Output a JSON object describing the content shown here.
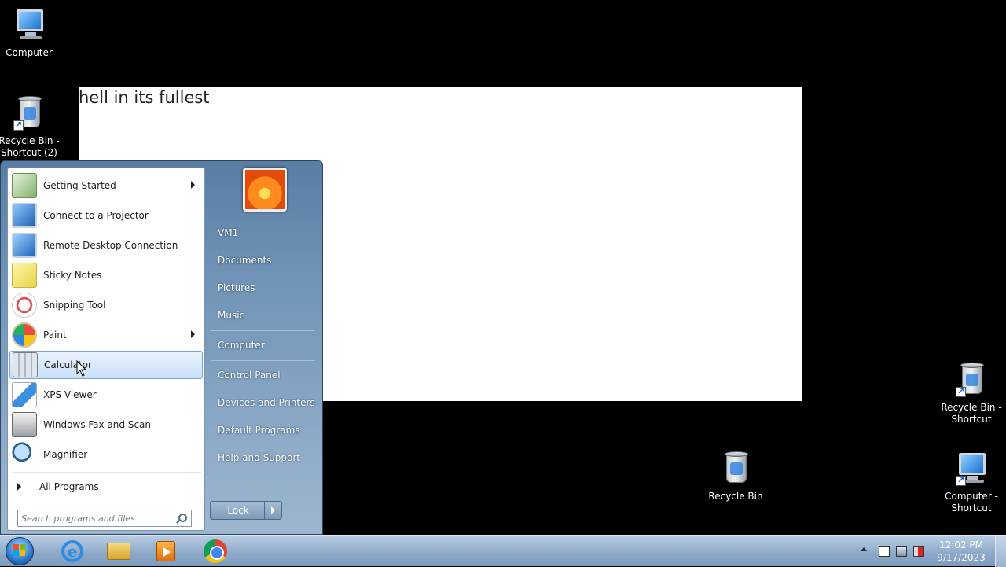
{
  "desktop_icons": {
    "computer": "Computer",
    "recycle_shortcut_2": "Recycle Bin - Shortcut (2)",
    "recycle_bin": "Recycle Bin",
    "recycle_shortcut": "Recycle Bin - Shortcut",
    "computer_shortcut": "Computer - Shortcut"
  },
  "note_window": {
    "text": "hell in its fullest"
  },
  "start_menu": {
    "programs": [
      {
        "label": "Getting Started",
        "icon": "getting-started-icon",
        "submenu": true
      },
      {
        "label": "Connect to a Projector",
        "icon": "projector-icon",
        "submenu": false
      },
      {
        "label": "Remote Desktop Connection",
        "icon": "remote-desktop-icon",
        "submenu": false
      },
      {
        "label": "Sticky Notes",
        "icon": "sticky-notes-icon",
        "submenu": false
      },
      {
        "label": "Snipping Tool",
        "icon": "snipping-tool-icon",
        "submenu": false
      },
      {
        "label": "Paint",
        "icon": "paint-icon",
        "submenu": true
      },
      {
        "label": "Calculator",
        "icon": "calculator-icon",
        "submenu": false,
        "highlighted": true
      },
      {
        "label": "XPS Viewer",
        "icon": "xps-viewer-icon",
        "submenu": false
      },
      {
        "label": "Windows Fax and Scan",
        "icon": "fax-scan-icon",
        "submenu": false
      },
      {
        "label": "Magnifier",
        "icon": "magnifier-icon",
        "submenu": false
      }
    ],
    "all_programs": "All Programs",
    "search_placeholder": "Search programs and files",
    "right_items": {
      "user": "VM1",
      "documents": "Documents",
      "pictures": "Pictures",
      "music": "Music",
      "computer": "Computer",
      "control_panel": "Control Panel",
      "devices": "Devices and Printers",
      "default_programs": "Default Programs",
      "help": "Help and Support"
    },
    "lock_label": "Lock"
  },
  "taskbar": {
    "apps": [
      "internet-explorer-icon",
      "windows-explorer-icon",
      "media-player-icon",
      "chrome-icon"
    ],
    "clock_time": "12:02 PM",
    "clock_date": "9/17/2023"
  },
  "colors": {
    "accent": "#7da2ce",
    "taskbar": "#8ca8c8",
    "menu": "#6f92b6"
  }
}
